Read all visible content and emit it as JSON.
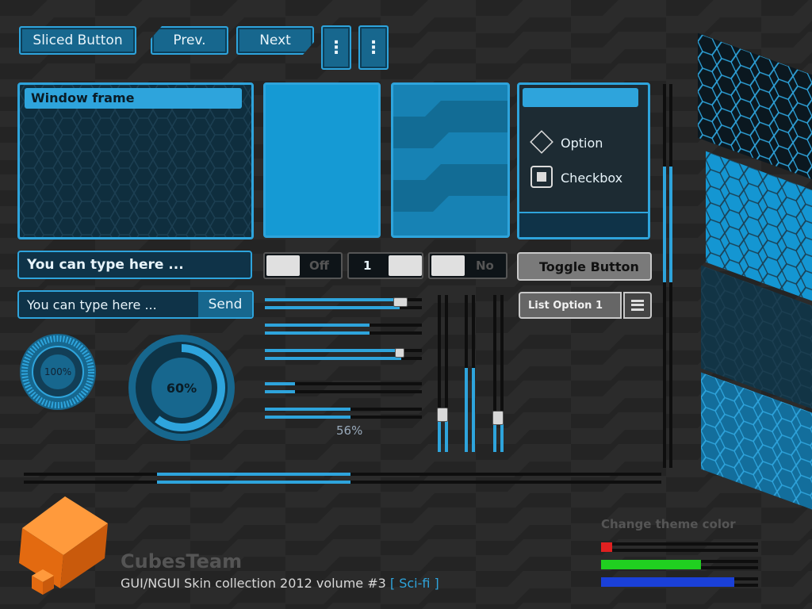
{
  "colors": {
    "accent": "#2ea4dc",
    "panel": "#0f2e3e",
    "bright": "#159ad4",
    "bg": "#242424"
  },
  "buttons": {
    "sliced": "Sliced Button",
    "prev": "Prev.",
    "next": "Next",
    "more1": "⋮",
    "more2": "⋮"
  },
  "window": {
    "title": "Window frame"
  },
  "options": {
    "option_label": "Option",
    "checkbox_label": "Checkbox"
  },
  "inputs": {
    "bold_input_value": "You can type here ...",
    "chat_input_value": "You can type here ...",
    "send": "Send"
  },
  "toggles": {
    "off": "Off",
    "number": "1",
    "no": "No"
  },
  "toggle_button": "Toggle Button",
  "list": {
    "selected": "List Option 1"
  },
  "progress": {
    "ring_small": "100%",
    "ring_large": "60%",
    "slider_value": "56%"
  },
  "progress_values": {
    "ring_small": 1.0,
    "ring_large": 0.6,
    "slider": 0.56
  },
  "theme": {
    "title": "Change theme color",
    "swatches": [
      "#e02020",
      "#20d020",
      "#1a40d8"
    ]
  },
  "footer": {
    "team": "CubesTeam",
    "collection": "GUI/NGUI Skin collection 2012 volume #3",
    "theme_tag": "[ Sci-fi ]"
  }
}
